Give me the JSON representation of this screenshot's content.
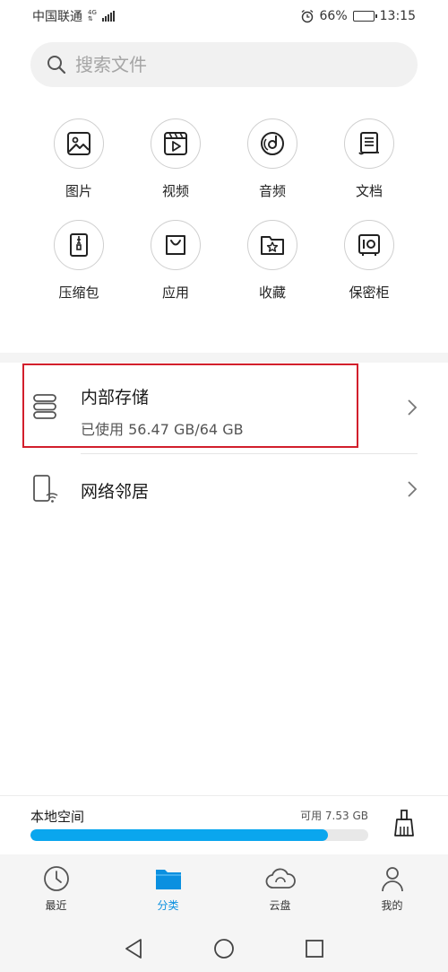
{
  "status": {
    "carrier": "中国联通",
    "net_top": "4G",
    "net_bottom": "⇅",
    "battery_level": "66%",
    "battery_fraction": 0.66,
    "time": "13:15"
  },
  "search": {
    "placeholder": "搜索文件"
  },
  "categories": [
    {
      "label": "图片",
      "icon": "image-icon"
    },
    {
      "label": "视频",
      "icon": "video-icon"
    },
    {
      "label": "音频",
      "icon": "audio-icon"
    },
    {
      "label": "文档",
      "icon": "document-icon"
    },
    {
      "label": "压缩包",
      "icon": "archive-icon"
    },
    {
      "label": "应用",
      "icon": "app-bag-icon"
    },
    {
      "label": "收藏",
      "icon": "favorite-folder-icon"
    },
    {
      "label": "保密柜",
      "icon": "safe-icon"
    }
  ],
  "storage": {
    "internal_title": "内部存储",
    "internal_usage": "已使用 56.47 GB/64 GB",
    "network_title": "网络邻居"
  },
  "local_space": {
    "title": "本地空间",
    "available": "可用 7.53 GB",
    "used_fraction": 0.88
  },
  "tabs": [
    {
      "label": "最近",
      "icon": "clock-icon",
      "active": false
    },
    {
      "label": "分类",
      "icon": "folder-icon",
      "active": true
    },
    {
      "label": "云盘",
      "icon": "cloud-icon",
      "active": false
    },
    {
      "label": "我的",
      "icon": "person-icon",
      "active": false
    }
  ],
  "colors": {
    "accent": "#0a90e0",
    "progress": "#0aa6ee",
    "highlight": "#d21f2c"
  }
}
